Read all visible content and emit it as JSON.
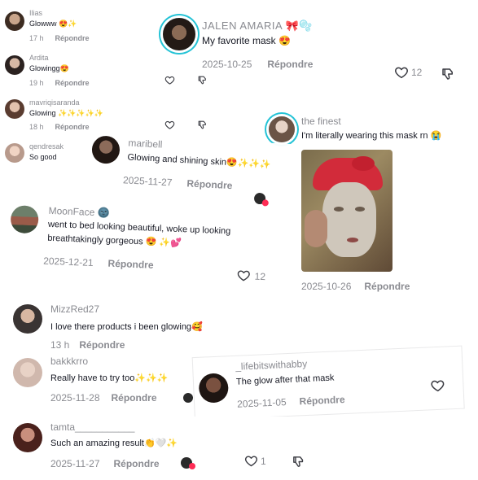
{
  "comments": [
    {
      "user": "Ilias",
      "text": "Glowww 😍✨",
      "time": "17 h",
      "reply": "Répondre"
    },
    {
      "user": "Ardita",
      "text": "Glowingg😍",
      "time": "19 h",
      "reply": "Répondre"
    },
    {
      "user": "mavriqisaranda",
      "text": "Glowing ✨✨✨✨✨",
      "time": "18 h",
      "reply": "Répondre"
    },
    {
      "user": "qendresak",
      "text": "So good"
    },
    {
      "user": "JALEN AMARIA 🎀🫧",
      "text": "My favorite mask 😍",
      "time": "2025-10-25",
      "reply": "Répondre",
      "likes": "12"
    },
    {
      "user": "maribell",
      "text": "Glowing and shining skin😍✨✨✨",
      "time": "2025-11-27",
      "reply": "Répondre"
    },
    {
      "user": "the finest",
      "text": "I'm literally wearing this mask rn 😭",
      "time": "2025-10-26",
      "reply": "Répondre"
    },
    {
      "user": "MoonFace 🌚",
      "text_line1": "went to bed looking beautiful, woke up looking",
      "text_line2": "breathtakingly gorgeous 😍 ✨💕",
      "time": "2025-12-21",
      "reply": "Répondre",
      "likes": "12"
    },
    {
      "user": "MizzRed27",
      "text": "I love there products i been glowing🥰",
      "time": "13 h",
      "reply": "Répondre"
    },
    {
      "user": "bakkkrro",
      "text": "Really have to try too✨✨✨",
      "time": "2025-11-28",
      "reply": "Répondre"
    },
    {
      "user": "_lifebitswithabby",
      "text": "The glow after that mask",
      "time": "2025-11-05",
      "reply": "Répondre"
    },
    {
      "user": "tamta___________",
      "text": "Such an amazing result👏🤍✨",
      "time": "2025-11-27",
      "reply": "Répondre",
      "likes": "1"
    }
  ],
  "colors": {
    "username": "#8a8b91",
    "text": "#161823",
    "ring": "#25c3d6",
    "liked": "#fe2c55"
  },
  "icons": [
    "heart-icon",
    "dislike-icon",
    "creator-liked-avatar"
  ]
}
